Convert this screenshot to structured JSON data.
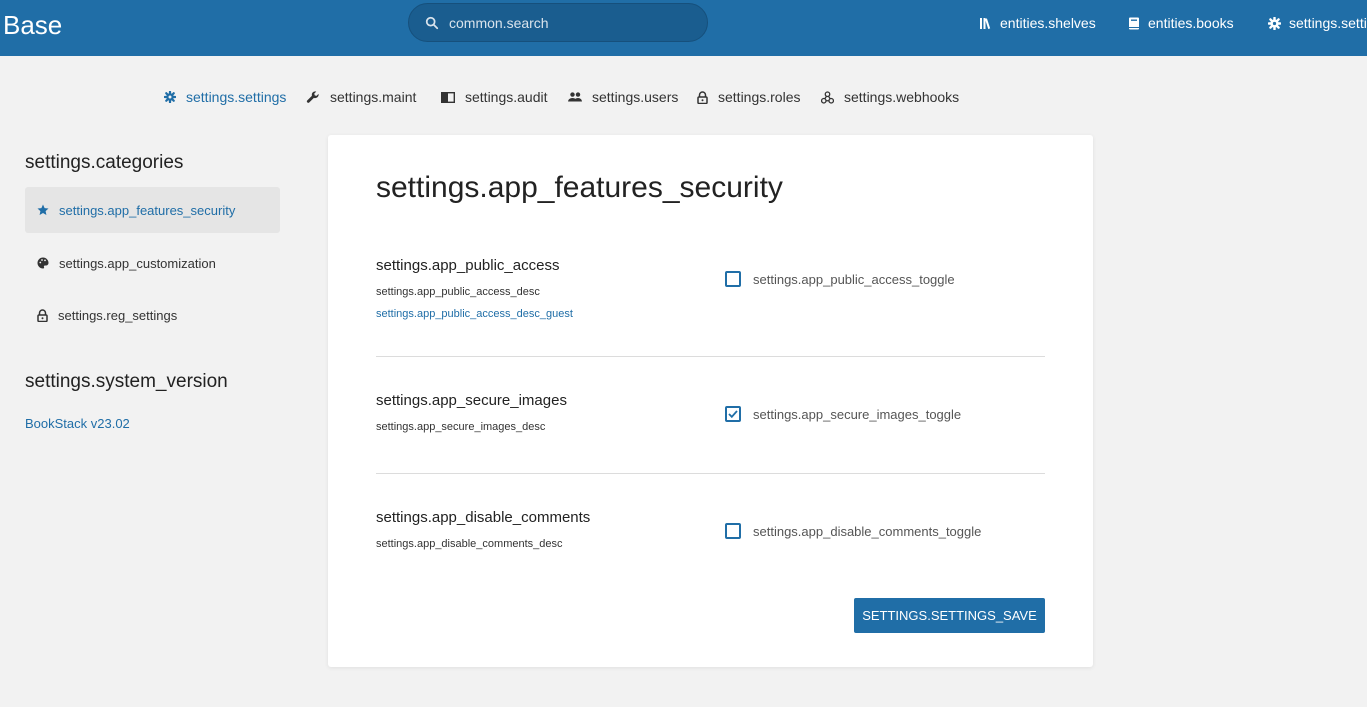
{
  "header": {
    "logo": "Base",
    "search_placeholder": "common.search",
    "nav": [
      {
        "label": "entities.shelves",
        "icon": "shelves-icon"
      },
      {
        "label": "entities.books",
        "icon": "book-icon"
      },
      {
        "label": "settings.setti",
        "icon": "gear-icon"
      }
    ]
  },
  "tabs": [
    {
      "label": "settings.settings",
      "icon": "gear-icon",
      "active": true
    },
    {
      "label": "settings.maint",
      "icon": "wrench-icon"
    },
    {
      "label": "settings.audit",
      "icon": "open-book-icon"
    },
    {
      "label": "settings.users",
      "icon": "users-icon"
    },
    {
      "label": "settings.roles",
      "icon": "lock-icon"
    },
    {
      "label": "settings.webhooks",
      "icon": "webhook-icon"
    }
  ],
  "sidebar": {
    "categories_heading": "settings.categories",
    "items": [
      {
        "label": "settings.app_features_security",
        "icon": "star-icon",
        "active": true
      },
      {
        "label": "settings.app_customization",
        "icon": "palette-icon"
      },
      {
        "label": "settings.reg_settings",
        "icon": "lock-icon"
      }
    ],
    "version_heading": "settings.system_version",
    "version_link": "BookStack v23.02"
  },
  "main": {
    "title": "settings.app_features_security",
    "settings": [
      {
        "label": "settings.app_public_access",
        "desc": "settings.app_public_access_desc",
        "link": "settings.app_public_access_desc_guest",
        "toggle_label": "settings.app_public_access_toggle",
        "checked": false
      },
      {
        "label": "settings.app_secure_images",
        "desc": "settings.app_secure_images_desc",
        "toggle_label": "settings.app_secure_images_toggle",
        "checked": true
      },
      {
        "label": "settings.app_disable_comments",
        "desc": "settings.app_disable_comments_desc",
        "toggle_label": "settings.app_disable_comments_toggle",
        "checked": false
      }
    ],
    "save_label": "settings.settings_save"
  },
  "colors": {
    "accent": "#206ea7",
    "header_bg": "#206ea7",
    "page_bg": "#f2f2f2"
  }
}
